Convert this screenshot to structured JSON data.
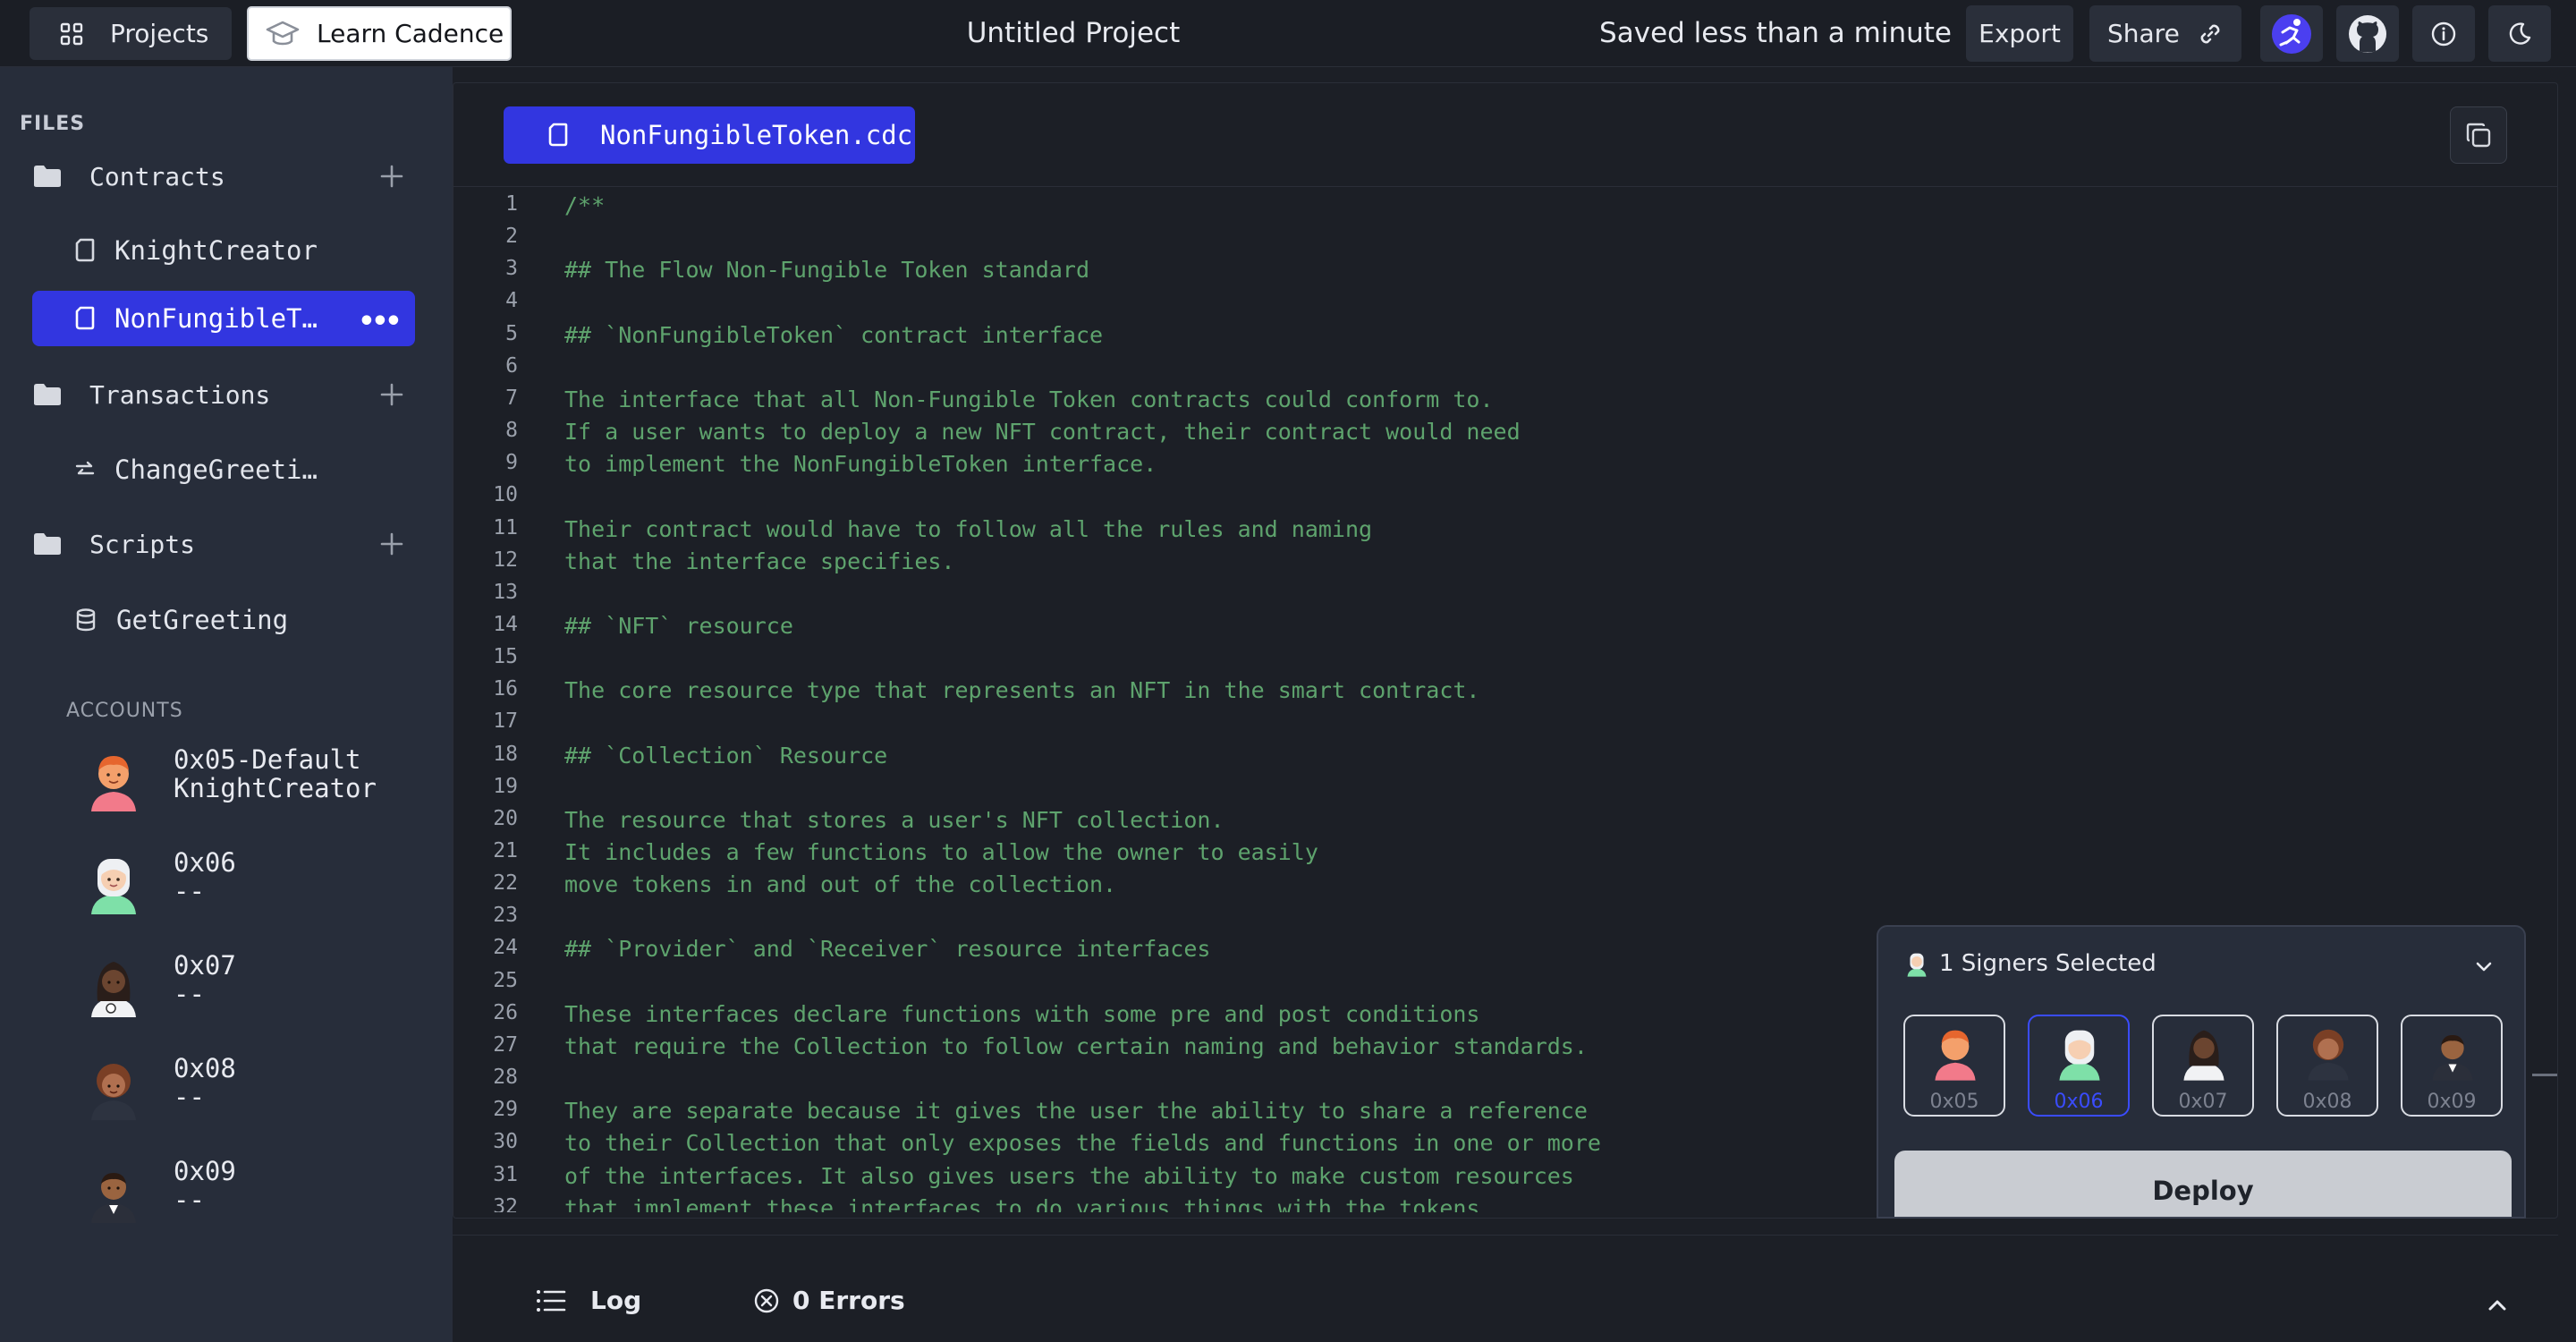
{
  "header": {
    "projects_label": "Projects",
    "learn_label": "Learn Cadence",
    "project_title": "Untitled Project",
    "saved_status": "Saved less than a minute",
    "export_label": "Export",
    "share_label": "Share"
  },
  "sidebar": {
    "files_heading": "FILES",
    "contracts_label": "Contracts",
    "contracts": [
      {
        "label": "KnightCreator"
      },
      {
        "label": "NonFungibleToken",
        "active": true
      }
    ],
    "transactions_label": "Transactions",
    "transactions": [
      {
        "label": "ChangeGreeting"
      }
    ],
    "scripts_label": "Scripts",
    "scripts": [
      {
        "label": "GetGreeting"
      }
    ],
    "accounts_heading": "ACCOUNTS",
    "accounts": [
      {
        "name": "0x05-Default\nKnightCreator",
        "avatar": "avatar-orange"
      },
      {
        "name": "0x06\n--",
        "avatar": "avatar-white-hair"
      },
      {
        "name": "0x07\n--",
        "avatar": "avatar-dark-long-hair"
      },
      {
        "name": "0x08\n--",
        "avatar": "avatar-brown-curly"
      },
      {
        "name": "0x09\n--",
        "avatar": "avatar-suit"
      }
    ]
  },
  "editor": {
    "tab_label": "NonFungibleToken.cdc",
    "lines": [
      "/**",
      "",
      "## The Flow Non-Fungible Token standard",
      "",
      "## `NonFungibleToken` contract interface",
      "",
      "The interface that all Non-Fungible Token contracts could conform to.",
      "If a user wants to deploy a new NFT contract, their contract would need",
      "to implement the NonFungibleToken interface.",
      "",
      "Their contract would have to follow all the rules and naming",
      "that the interface specifies.",
      "",
      "## `NFT` resource",
      "",
      "The core resource type that represents an NFT in the smart contract.",
      "",
      "## `Collection` Resource",
      "",
      "The resource that stores a user's NFT collection.",
      "It includes a few functions to allow the owner to easily",
      "move tokens in and out of the collection.",
      "",
      "## `Provider` and `Receiver` resource interfaces",
      "",
      "These interfaces declare functions with some pre and post conditions",
      "that require the Collection to follow certain naming and behavior standards.",
      "",
      "They are separate because it gives the user the ability to share a reference",
      "to their Collection that only exposes the fields and functions in one or more",
      "of the interfaces. It also gives users the ability to make custom resources",
      "that implement these interfaces to do various things with the tokens."
    ]
  },
  "signers": {
    "title": "1 Signers Selected",
    "options": [
      {
        "label": "0x05",
        "selected": false
      },
      {
        "label": "0x06",
        "selected": true
      },
      {
        "label": "0x07",
        "selected": false
      },
      {
        "label": "0x08",
        "selected": false
      },
      {
        "label": "0x09",
        "selected": false
      }
    ],
    "deploy_label": "Deploy"
  },
  "bottom": {
    "log_label": "Log",
    "errors_label": "0 Errors"
  },
  "colors": {
    "accent": "#3236E0",
    "sidebar_bg": "#272D3A",
    "editor_bg": "#1C1F26",
    "code_comment": "#5EA36D"
  }
}
